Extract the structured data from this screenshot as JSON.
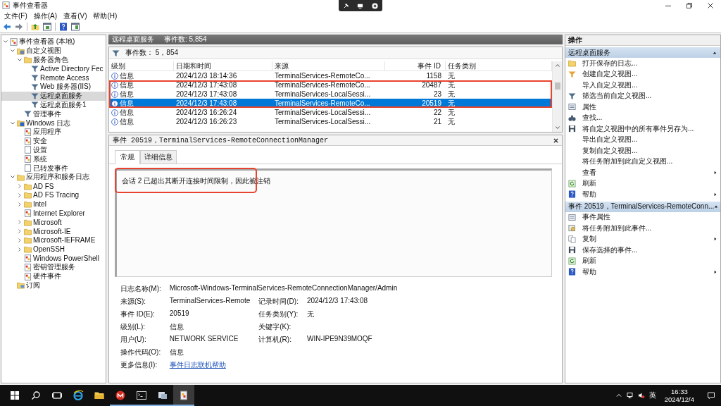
{
  "window": {
    "title": "事件查看器"
  },
  "menu": [
    "文件(F)",
    "操作(A)",
    "查看(V)",
    "帮助(H)"
  ],
  "tree": [
    {
      "label": "事件查看器 (本地)",
      "kind": "viewer",
      "selected": false,
      "expanded": true,
      "children": [
        {
          "label": "自定义视图",
          "kind": "folder-filter",
          "selected": false,
          "expanded": true,
          "children": [
            {
              "label": "服务器角色",
              "kind": "folder",
              "selected": false,
              "expanded": true,
              "children": [
                {
                  "label": "Active Directory Fec",
                  "kind": "filter",
                  "selected": false
                },
                {
                  "label": "Remote Access",
                  "kind": "filter",
                  "selected": false
                },
                {
                  "label": "Web 服务器(IIS)",
                  "kind": "filter",
                  "selected": false
                },
                {
                  "label": "远程桌面服务",
                  "kind": "filter",
                  "selected": true
                },
                {
                  "label": "远程桌面服务1",
                  "kind": "filter",
                  "selected": false
                }
              ]
            },
            {
              "label": "管理事件",
              "kind": "filter",
              "selected": false
            }
          ]
        },
        {
          "label": "Windows 日志",
          "kind": "windows-log",
          "selected": false,
          "expanded": true,
          "children": [
            {
              "label": "应用程序",
              "kind": "log",
              "selected": false
            },
            {
              "label": "安全",
              "kind": "log",
              "selected": false
            },
            {
              "label": "设置",
              "kind": "log-plain",
              "selected": false
            },
            {
              "label": "系统",
              "kind": "log",
              "selected": false
            },
            {
              "label": "已转发事件",
              "kind": "log-plain",
              "selected": false
            }
          ]
        },
        {
          "label": "应用程序和服务日志",
          "kind": "open-folder",
          "selected": false,
          "expanded": true,
          "children": [
            {
              "label": "AD FS",
              "kind": "folder",
              "selected": false,
              "expanded": false
            },
            {
              "label": "AD FS Tracing",
              "kind": "folder",
              "selected": false,
              "expanded": false
            },
            {
              "label": "Intel",
              "kind": "folder",
              "selected": false,
              "expanded": false
            },
            {
              "label": "Internet Explorer",
              "kind": "log",
              "selected": false
            },
            {
              "label": "Microsoft",
              "kind": "folder",
              "selected": false,
              "expanded": false
            },
            {
              "label": "Microsoft-IE",
              "kind": "folder",
              "selected": false,
              "expanded": false
            },
            {
              "label": "Microsoft-IEFRAME",
              "kind": "folder",
              "selected": false,
              "expanded": false
            },
            {
              "label": "OpenSSH",
              "kind": "folder",
              "selected": false,
              "expanded": false
            },
            {
              "label": "Windows PowerShell",
              "kind": "log",
              "selected": false
            },
            {
              "label": "密钥管理服务",
              "kind": "log",
              "selected": false
            },
            {
              "label": "硬件事件",
              "kind": "log",
              "selected": false
            }
          ]
        },
        {
          "label": "订阅",
          "kind": "subscription",
          "selected": false
        }
      ]
    }
  ],
  "view_header": {
    "title": "远程桌面服务",
    "count": "事件数: 5,854"
  },
  "filter_bar": {
    "count": "事件数： 5，854"
  },
  "table": {
    "columns": [
      "级别",
      "日期和时间",
      "来源",
      "事件 ID",
      "任务类别"
    ],
    "rows": [
      {
        "level": "信息",
        "date": "2024/12/3 18:14:36",
        "source": "TerminalServices-RemoteCo...",
        "event_id": "1158",
        "task": "无",
        "selected": false,
        "highlighted": false
      },
      {
        "level": "信息",
        "date": "2024/12/3 17:43:08",
        "source": "TerminalServices-RemoteCo...",
        "event_id": "20487",
        "task": "无",
        "selected": false,
        "highlighted": true
      },
      {
        "level": "信息",
        "date": "2024/12/3 17:43:08",
        "source": "TerminalServices-LocalSessi...",
        "event_id": "23",
        "task": "无",
        "selected": false,
        "highlighted": true
      },
      {
        "level": "信息",
        "date": "2024/12/3 17:43:08",
        "source": "TerminalServices-RemoteCo...",
        "event_id": "20519",
        "task": "无",
        "selected": true,
        "highlighted": true
      },
      {
        "level": "信息",
        "date": "2024/12/3 16:26:24",
        "source": "TerminalServices-LocalSessi...",
        "event_id": "22",
        "task": "无",
        "selected": false,
        "highlighted": false
      },
      {
        "level": "信息",
        "date": "2024/12/3 16:26:23",
        "source": "TerminalServices-LocalSessi...",
        "event_id": "21",
        "task": "无",
        "selected": false,
        "highlighted": false
      }
    ]
  },
  "detail": {
    "title": "事件 20519，TerminalServices-RemoteConnectionManager",
    "tabs": [
      {
        "label": "常规",
        "selected": true
      },
      {
        "label": "详细信息",
        "selected": false
      }
    ],
    "message": {
      "text": "会话 2 已超出其断开连接时间限制，因此被注销",
      "highlighted": true
    },
    "fields": [
      {
        "label": "日志名称(M):",
        "value": "Microsoft-Windows-TerminalServices-RemoteConnectionManager/Admin"
      },
      {
        "label": "来源(S):",
        "value": "TerminalServices-Remote",
        "extra": {
          "label": "记录时间(D):",
          "value": "2024/12/3 17:43:08"
        }
      },
      {
        "label": "事件 ID(E):",
        "value": "20519",
        "extra": {
          "label": "任务类别(Y):",
          "value": "无"
        }
      },
      {
        "label": "级别(L):",
        "value": "信息",
        "extra": {
          "label": "关键字(K):"
        }
      },
      {
        "label": "用户(U):",
        "value": "NETWORK SERVICE",
        "extra": {
          "label": "计算机(R):",
          "value": "WIN-IPE9N39MOQF"
        }
      },
      {
        "label": "操作代码(O):",
        "value": "信息"
      },
      {
        "label": "更多信息(I):",
        "value": "事件日志联机帮助",
        "kind": "link"
      }
    ]
  },
  "actions": {
    "title": "操作",
    "sections": [
      {
        "title": "远程桌面服务",
        "expanded": true,
        "items": [
          {
            "label": "打开保存的日志...",
            "kind": "open-log"
          },
          {
            "label": "创建自定义视图...",
            "kind": "filter-create"
          },
          {
            "label": "导入自定义视图..."
          },
          {
            "label": "筛选当前自定义视图...",
            "kind": "filter"
          },
          {
            "label": "属性",
            "kind": "properties"
          },
          {
            "label": "查找...",
            "kind": "find"
          },
          {
            "label": "将自定义视图中的所有事件另存为...",
            "kind": "save"
          },
          {
            "label": "导出自定义视图..."
          },
          {
            "label": "复制自定义视图..."
          },
          {
            "label": "将任务附加到此自定义视图..."
          },
          {
            "label": "查看",
            "submenu": true
          },
          {
            "label": "刷新",
            "kind": "refresh"
          },
          {
            "label": "帮助",
            "kind": "help",
            "submenu": true
          }
        ]
      },
      {
        "title": "事件 20519，TerminalServices-RemoteConn...",
        "expanded": true,
        "items": [
          {
            "label": "事件属性",
            "kind": "properties"
          },
          {
            "label": "将任务附加到此事件...",
            "kind": "attach-task"
          },
          {
            "label": "复制",
            "kind": "copy",
            "submenu": true
          },
          {
            "label": "保存选择的事件...",
            "kind": "save"
          },
          {
            "label": "刷新",
            "kind": "refresh"
          },
          {
            "label": "帮助",
            "kind": "help",
            "submenu": true
          }
        ]
      }
    ]
  },
  "taskbar": {
    "language": "英",
    "time": "16:33",
    "date": "2024/12/4"
  }
}
